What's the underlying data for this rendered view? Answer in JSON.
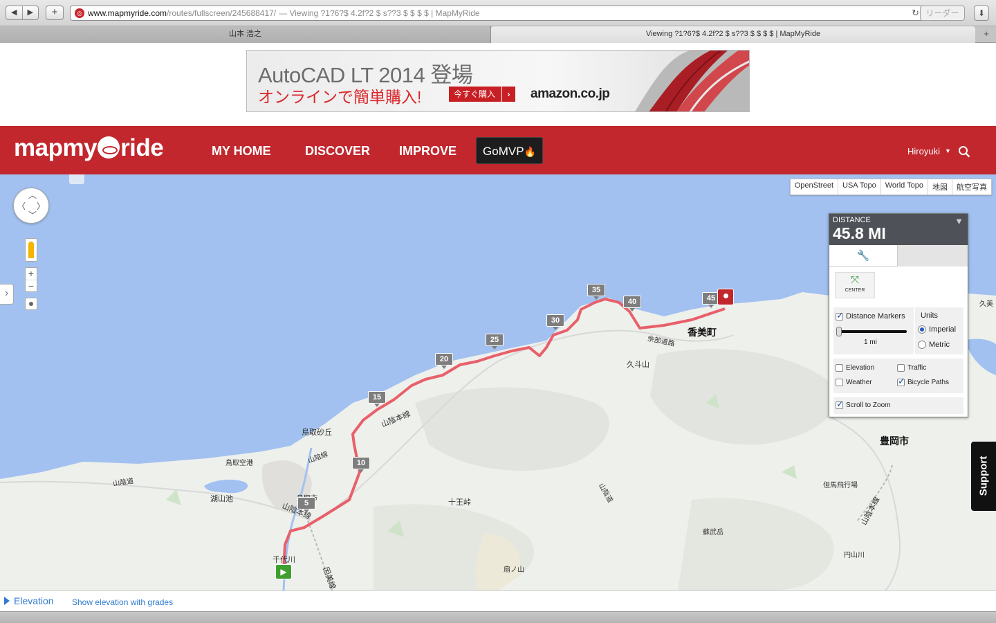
{
  "browser": {
    "url_domain": "www.mapmyride.com",
    "url_path": "/routes/fullscreen/245688417/",
    "url_title": "— Viewing ?1?6?$ 4.2f?2 $ s??3 $ $ $ $ | MapMyRide",
    "reader_label": "リーダー",
    "tabs": [
      {
        "label": "山本 浩之"
      },
      {
        "label": "Viewing ?1?6?$ 4.2f?2 $ s??3 $ $ $ $ | MapMyRide"
      }
    ]
  },
  "ad": {
    "title": "AutoCAD LT 2014 登場",
    "subtitle": "オンラインで簡単購入!",
    "buy_label": "今すぐ購入",
    "buy_arrow": "›",
    "brand": "amazon.co.jp"
  },
  "header": {
    "logo_left": "mapmy",
    "logo_right": "ride",
    "nav": [
      "MY HOME",
      "DISCOVER",
      "IMPROVE"
    ],
    "mvp_label": "GoMVP",
    "username": "Hiroyuki"
  },
  "map": {
    "layers": [
      "OpenStreet",
      "USA Topo",
      "World Topo",
      "地図",
      "航空写真"
    ],
    "labels": [
      {
        "text": "香美町",
        "size": "big"
      },
      {
        "text": "豊岡市",
        "size": "big"
      },
      {
        "text": "久斗山",
        "size": "mid"
      },
      {
        "text": "余部道路",
        "size": "small"
      },
      {
        "text": "山陰本線",
        "size": "mid"
      },
      {
        "text": "鳥取砂丘",
        "size": "mid"
      },
      {
        "text": "鳥取空港",
        "size": "small"
      },
      {
        "text": "山陰道",
        "size": "small"
      },
      {
        "text": "湖山池",
        "size": "mid"
      },
      {
        "text": "鳥取市",
        "size": "small"
      },
      {
        "text": "山陰本線",
        "size": "mid"
      },
      {
        "text": "千代川",
        "size": "mid"
      },
      {
        "text": "因美線",
        "size": "mid"
      },
      {
        "text": "十王峠",
        "size": "mid"
      },
      {
        "text": "山陰道",
        "size": "small"
      },
      {
        "text": "但馬飛行場",
        "size": "small"
      },
      {
        "text": "山陰本線",
        "size": "mid"
      },
      {
        "text": "蘇武岳",
        "size": "small"
      },
      {
        "text": "円山川",
        "size": "small"
      },
      {
        "text": "扇ノ山",
        "size": "small"
      },
      {
        "text": "久美",
        "size": "small"
      },
      {
        "text": "山陰線",
        "size": "small"
      }
    ],
    "mile_markers": [
      "5",
      "10",
      "15",
      "20",
      "25",
      "30",
      "35",
      "40",
      "45"
    ],
    "support_label": "Support"
  },
  "panel": {
    "distance_label": "DISTANCE",
    "distance_value": "45.8 MI",
    "center_label": "CENTER",
    "distance_markers_label": "Distance Markers",
    "distance_markers_checked": true,
    "slider_label": "1 mi",
    "units_label": "Units",
    "units_options": [
      "Imperial",
      "Metric"
    ],
    "units_selected": "Imperial",
    "toggles": [
      {
        "label": "Elevation",
        "checked": false
      },
      {
        "label": "Traffic",
        "checked": false
      },
      {
        "label": "Weather",
        "checked": false
      },
      {
        "label": "Bicycle Paths",
        "checked": true
      },
      {
        "label": "Scroll to Zoom",
        "checked": true
      }
    ]
  },
  "elevation": {
    "label": "Elevation",
    "link": "Show elevation with grades"
  },
  "colors": {
    "brand_red": "#c1272d",
    "route": "#e8606a",
    "water": "#a2c1f0",
    "land": "#eef0ec",
    "link_blue": "#2f7bd0"
  }
}
